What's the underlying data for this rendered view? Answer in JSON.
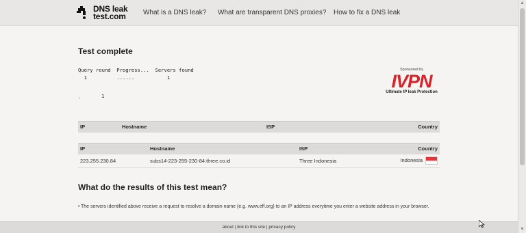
{
  "header": {
    "logo_line1": "DNS leak",
    "logo_line2": "test.com",
    "nav": [
      "What is a DNS leak?",
      "What are transparent DNS proxies?",
      "How to fix a DNS leak"
    ]
  },
  "test": {
    "heading": "Test complete",
    "progress_header": "Query round  Progress...  Servers found",
    "progress_row": "  1          ......           1",
    "dot": ".",
    "count": "1"
  },
  "sponsor": {
    "small": "Sponsored by",
    "brand": "IVPN",
    "tagline": "Ultimate IP leak Protection",
    "brand_color": "#d8232a"
  },
  "table1": {
    "headers": [
      "IP",
      "Hostname",
      "ISP",
      "Country"
    ]
  },
  "table2": {
    "headers": [
      "IP",
      "Hostname",
      "ISP",
      "Country"
    ],
    "rows": [
      {
        "ip": "223.255.230.84",
        "hostname": "subs14-223-255-230-84.three.co.id",
        "isp": "Three Indonesia",
        "country": "Indonesia"
      }
    ]
  },
  "results": {
    "heading": "What do the results of this test mean?",
    "bullet1": "The servers identified above receive a request to resolve a domain name (e.g. www.eff.org) to an IP address everytime you enter a website address in your browser."
  },
  "footer": {
    "about": "about",
    "sep1": " | ",
    "link": "link to this site",
    "sep2": " | ",
    "privacy": "privacy policy"
  }
}
